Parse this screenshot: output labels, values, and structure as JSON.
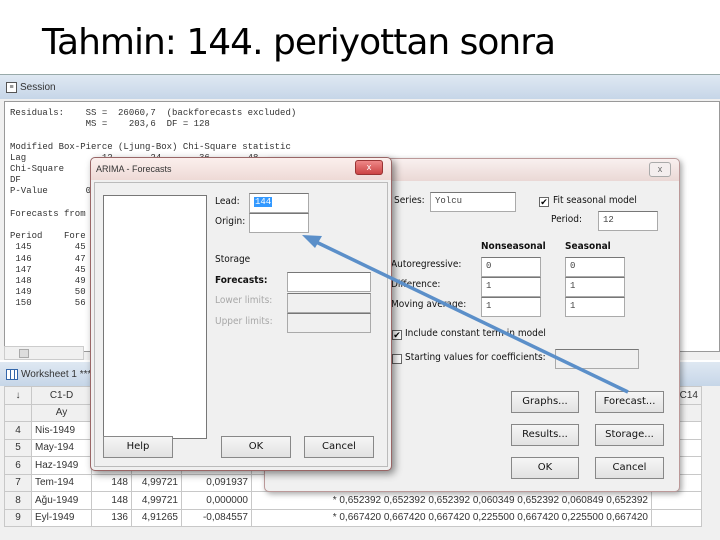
{
  "slide_title": "Tahmin: 144. periyottan sonra",
  "session": {
    "title": "Session",
    "lines": [
      "Residuals:    SS =  26060,7  (backforecasts excluded)",
      "              MS =    203,6  DF = 128",
      "",
      "Modified Box-Pierce (Ljung-Box) Chi-Square statistic",
      "Lag              12       24       36       48",
      "Chi-Square",
      "DF",
      "P-Value       0",
      "",
      "Forecasts from p",
      "",
      "Period    Fore",
      " 145        45",
      " 146        47",
      " 147        45",
      " 148        49",
      " 149        50",
      " 150        56"
    ]
  },
  "worksheet": {
    "title": "Worksheet 1 ***",
    "header_col": "C1-D",
    "header_name": "Ay",
    "right_header": "C14",
    "row_header_icon": "arrow-down-icon",
    "rows": [
      {
        "n": "4",
        "ay": "Nis-1949"
      },
      {
        "n": "5",
        "ay": "May-194"
      },
      {
        "n": "6",
        "ay": "Haz-1949"
      },
      {
        "n": "7",
        "ay": "Tem-194",
        "c2": "148",
        "c3": "4,99721",
        "c4": "0,091937"
      },
      {
        "n": "8",
        "ay": "Ağu-1949",
        "c2": "148",
        "c3": "4,99721",
        "c4": "0,000000",
        "star": "*",
        "v": [
          "0,652392",
          "0,652392",
          "0,652392",
          "0,060349",
          "0,652392",
          "0,060849",
          "0,652392"
        ]
      },
      {
        "n": "9",
        "ay": "Eyl-1949",
        "c2": "136",
        "c3": "4,91265",
        "c4": "-0,084557",
        "star": "*",
        "v": [
          "0,667420",
          "0,667420",
          "0,667420",
          "0,225500",
          "0,667420",
          "0,225500",
          "0,667420"
        ]
      }
    ]
  },
  "arima": {
    "close_label": "x",
    "series_label": "Series:",
    "series_value": "Yolcu",
    "fit_seasonal_label": "Fit seasonal model",
    "fit_seasonal_checked": "✔",
    "period_label": "Period:",
    "period_value": "12",
    "nonseasonal_label": "Nonseasonal",
    "seasonal_label": "Seasonal",
    "autoregressive_label": "Autoregressive:",
    "difference_label": "Difference:",
    "moving_average_label": "Moving average:",
    "ar_nonseasonal": "0",
    "ar_seasonal": "0",
    "diff_nonseasonal": "1",
    "diff_seasonal": "1",
    "ma_nonseasonal": "1",
    "ma_seasonal": "1",
    "include_constant_label": "Include constant term in model",
    "include_constant_checked": "✔",
    "starting_values_label": "Starting values for coefficients:",
    "buttons": {
      "graphs": "Graphs...",
      "forecast": "Forecast...",
      "results": "Results...",
      "storage": "Storage...",
      "ok": "OK",
      "cancel": "Cancel"
    }
  },
  "forecasts": {
    "title": "ARIMA - Forecasts",
    "close_label": "x",
    "lead_label": "Lead:",
    "lead_value": "144",
    "origin_label": "Origin:",
    "origin_value": "",
    "storage_label": "Storage",
    "forecasts_label": "Forecasts:",
    "lower_limits_label": "Lower limits:",
    "upper_limits_label": "Upper limits:",
    "help": "Help",
    "ok": "OK",
    "cancel": "Cancel"
  },
  "colors": {
    "arrow": "#5b8fc9",
    "selection": "#3399ff"
  }
}
